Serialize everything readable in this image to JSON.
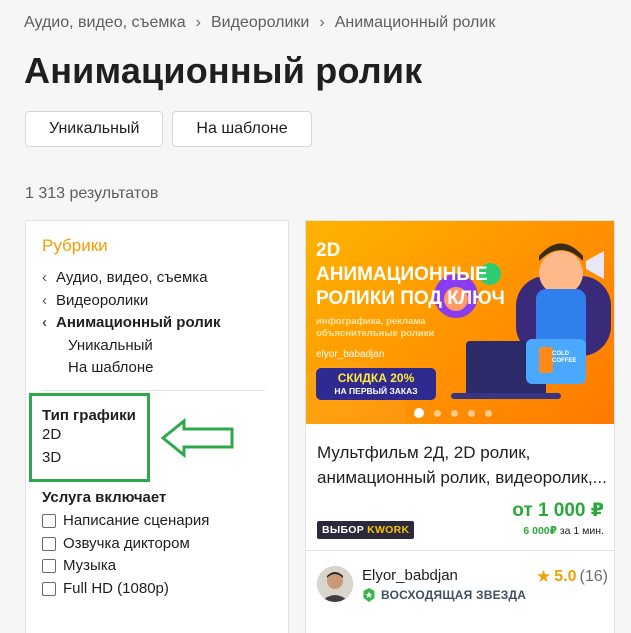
{
  "breadcrumb": {
    "items": [
      "Аудио, видео, съемка",
      "Видеоролики",
      "Анимационный ролик"
    ]
  },
  "page_title": "Анимационный ролик",
  "tabs": [
    "Уникальный",
    "На шаблоне"
  ],
  "results_count": "1 313 результатов",
  "sidebar": {
    "rubrics_title": "Рубрики",
    "rubrics": [
      {
        "label": "Аудио, видео, съемка"
      },
      {
        "label": "Видеоролики"
      },
      {
        "label": "Анимационный ролик"
      },
      {
        "label": "Уникальный"
      },
      {
        "label": "На шаблоне"
      }
    ],
    "graphic_type": {
      "title": "Тип графики",
      "options": [
        "2D",
        "3D"
      ]
    },
    "includes": {
      "title": "Услуга включает",
      "options": [
        "Написание сценария",
        "Озвучка диктором",
        "Музыка",
        "Full HD (1080p)"
      ]
    }
  },
  "card": {
    "banner": {
      "title": "2D АНИМАЦИОННЫЕ РОЛИКИ ПОД КЛЮЧ",
      "subtitle": "инфографика, реклама объяснительные ролики",
      "username": "elyor_babadjan",
      "discount_line1": "СКИДКА 20%",
      "discount_line2": "НА ПЕРВЫЙ ЗАКАЗ",
      "cup_label": "COLD COFFEE"
    },
    "title": "Мультфильм 2Д, 2D ролик, анимационный ролик, видеоролик,...",
    "badge_prefix": "ВЫБОР",
    "badge_brand": "KWORK",
    "price": "от 1 000 ₽",
    "price_sub_value": "6 000₽",
    "price_sub_text": "за 1 мин.",
    "seller": {
      "name": "Elyor_babdjan",
      "status": "ВОСХОДЯЩАЯ ЗВЕЗДА",
      "rating": "5.0",
      "reviews": "(16)"
    }
  },
  "colors": {
    "accent": "#f0a000",
    "price_green": "#2aa83a",
    "highlight_green": "#2ea84a"
  }
}
